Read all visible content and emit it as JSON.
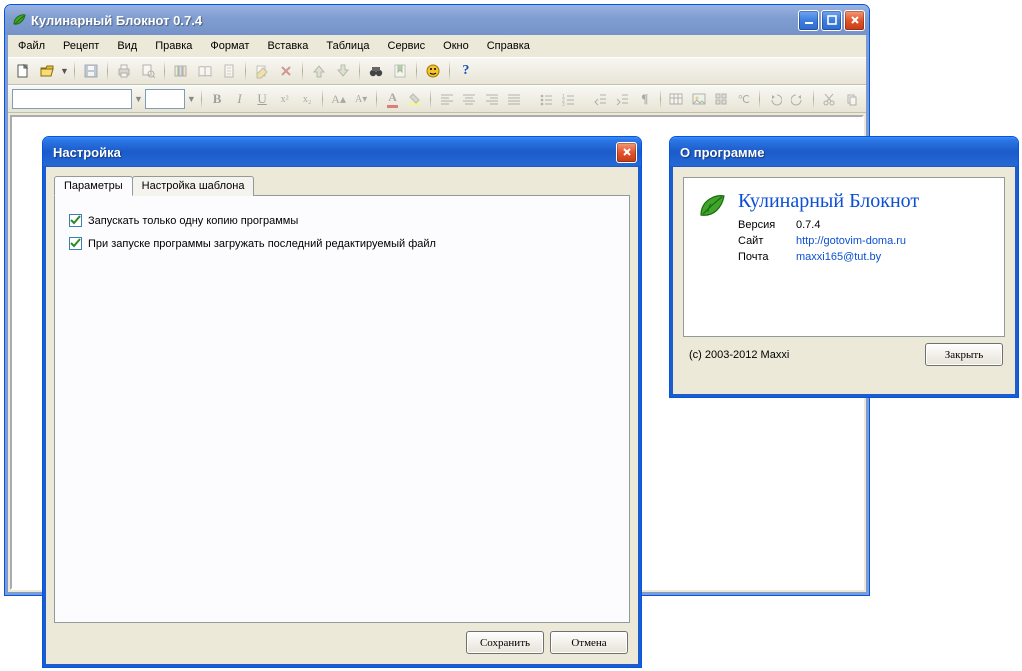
{
  "main_window": {
    "title": "Кулинарный Блокнот 0.7.4",
    "menus": [
      "Файл",
      "Рецепт",
      "Вид",
      "Правка",
      "Формат",
      "Вставка",
      "Таблица",
      "Сервис",
      "Окно",
      "Справка"
    ]
  },
  "settings_dialog": {
    "title": "Настройка",
    "tabs": [
      "Параметры",
      "Настройка шаблона"
    ],
    "active_tab": 0,
    "options": {
      "single_instance": "Запускать только одну копию программы",
      "load_last_file": "При запуске программы загружать последний редактируемый файл"
    },
    "buttons": {
      "save": "Сохранить",
      "cancel": "Отмена"
    }
  },
  "about_dialog": {
    "title": "О программе",
    "app_name": "Кулинарный Блокнот",
    "rows": {
      "version_label": "Версия",
      "version_value": "0.7.4",
      "site_label": "Сайт",
      "site_value": "http://gotovim-doma.ru",
      "mail_label": "Почта",
      "mail_value": "maxxi165@tut.by"
    },
    "copyright": "(c) 2003-2012 Maxxi",
    "close": "Закрыть"
  }
}
